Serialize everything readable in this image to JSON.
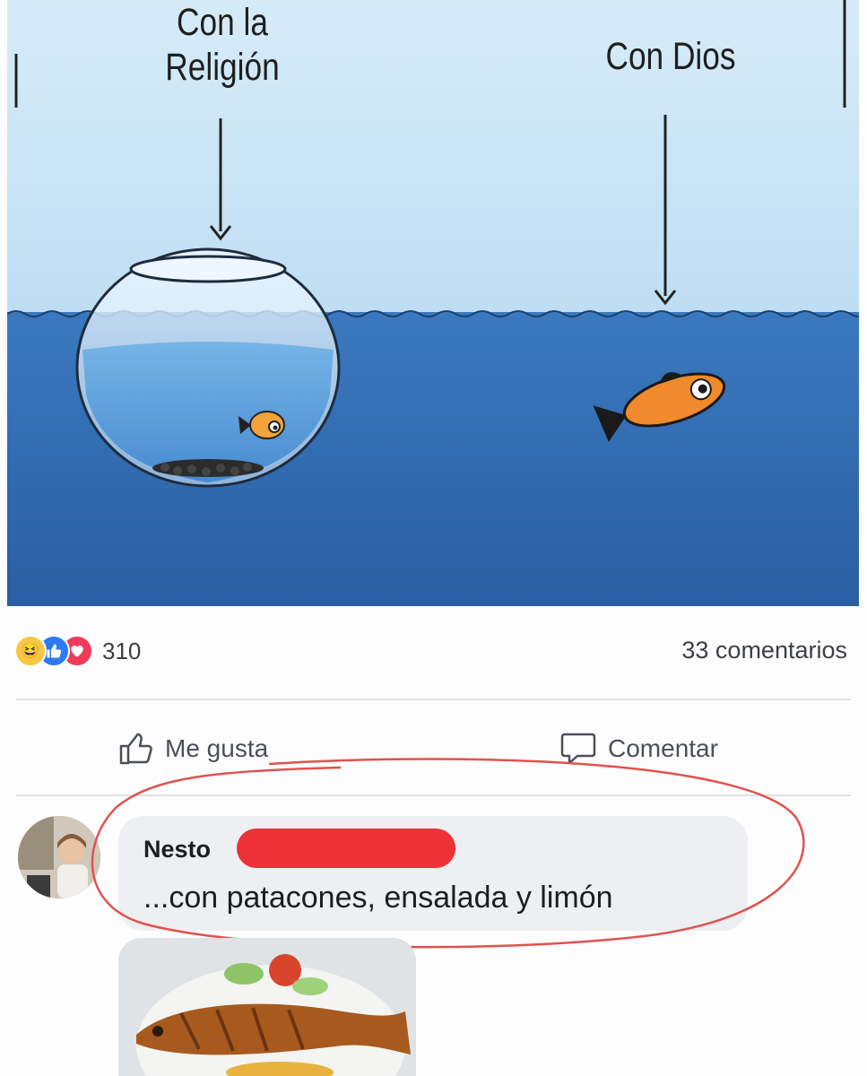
{
  "cartoon": {
    "label_left": "Con la\nReligión",
    "label_right": "Con Dios",
    "colors": {
      "sky": "#cfe6f5",
      "sea": "#2f68b0",
      "fish": "#f08a2c"
    }
  },
  "reactions": {
    "icons": [
      "haha-icon",
      "like-icon",
      "love-icon"
    ],
    "count": "310",
    "comments": "33 comentarios"
  },
  "actions": {
    "like_label": "Me gusta",
    "comment_label": "Comentar"
  },
  "comment": {
    "author": "Nesto",
    "text": "...con patacones, ensalada y limón",
    "highlight_color": "#e0524f"
  }
}
